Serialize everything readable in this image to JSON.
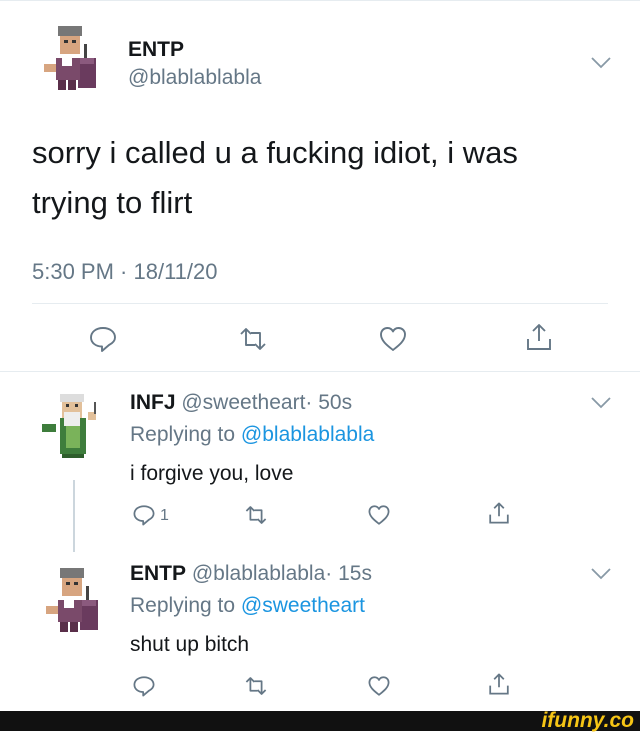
{
  "main_tweet": {
    "name": "ENTP",
    "handle": "@blablablabla",
    "text_line1": "sorry i called u a fucking idiot, i was",
    "text_line2": "trying to flirt",
    "timestamp": "5:30 PM · 18/11/20",
    "actions": [
      "reply-icon",
      "retweet-icon",
      "like-icon",
      "share-icon"
    ]
  },
  "replies": [
    {
      "name": "INFJ",
      "handle": "@sweetheart",
      "time": "· 50s",
      "replying_prefix": "Replying to",
      "replying_to": "@blablablabla",
      "text": "i forgive you, love",
      "reply_count": "1"
    },
    {
      "name": "ENTP",
      "handle": "@blablablabla",
      "time": "· 15s",
      "replying_prefix": "Replying to",
      "replying_to": "@sweetheart",
      "text": "shut up bitch",
      "reply_count": ""
    }
  ],
  "watermark": "ifunny.co",
  "colors": {
    "text": "#14171a",
    "secondary": "#657786",
    "link": "#1b95e0",
    "divider": "#e6ecf0",
    "watermark": "#f6c515"
  }
}
